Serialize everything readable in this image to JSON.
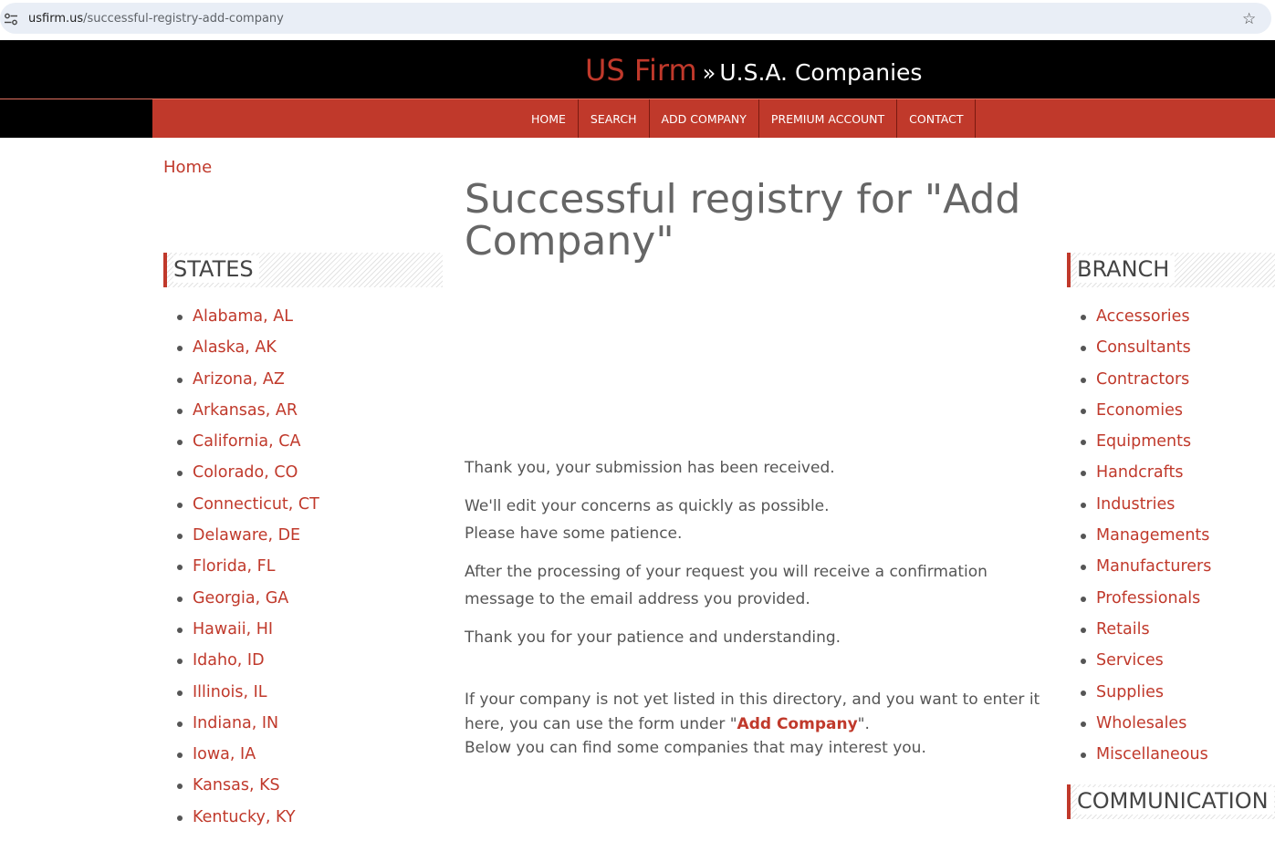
{
  "browser": {
    "url_domain": "usfirm.us",
    "url_path": "/successful-registry-add-company"
  },
  "header": {
    "brand_main": "US Firm",
    "brand_separator": "»",
    "brand_sub": "U.S.A. Companies",
    "accent_color": "#c0392b"
  },
  "nav": {
    "items": [
      {
        "label": "HOME"
      },
      {
        "label": "SEARCH"
      },
      {
        "label": "ADD COMPANY"
      },
      {
        "label": "PREMIUM ACCOUNT"
      },
      {
        "label": "CONTACT"
      }
    ]
  },
  "breadcrumb": {
    "home": "Home"
  },
  "states": {
    "heading": "STATES",
    "items": [
      "Alabama, AL",
      "Alaska, AK",
      "Arizona, AZ",
      "Arkansas, AR",
      "California, CA",
      "Colorado, CO",
      "Connecticut, CT",
      "Delaware, DE",
      "Florida, FL",
      "Georgia, GA",
      "Hawaii, HI",
      "Idaho, ID",
      "Illinois, IL",
      "Indiana, IN",
      "Iowa, IA",
      "Kansas, KS",
      "Kentucky, KY"
    ]
  },
  "branch": {
    "heading": "BRANCH",
    "items": [
      "Accessories",
      "Consultants",
      "Contractors",
      "Economies",
      "Equipments",
      "Handcrafts",
      "Industries",
      "Managements",
      "Manufacturers",
      "Professionals",
      "Retails",
      "Services",
      "Supplies",
      "Wholesales",
      "Miscellaneous"
    ]
  },
  "communication": {
    "heading": "COMMUNICATION"
  },
  "main": {
    "title": "Successful registry for \"Add Company\"",
    "p1": "Thank you, your submission has been received.",
    "p2_line1": "We'll edit your concerns as quickly as possible.",
    "p2_line2": "Please have some patience.",
    "p3": "After the processing of your request you will receive a confirmation message to the email address you provided.",
    "p4": "Thank you for your patience and understanding.",
    "p5_before": "If your company is not yet listed in this directory, and you want to enter it here, you can use the form under \"",
    "p5_link": "Add Company",
    "p5_after": "\".",
    "p5_line2": "Below you can find some companies that may interest you."
  }
}
